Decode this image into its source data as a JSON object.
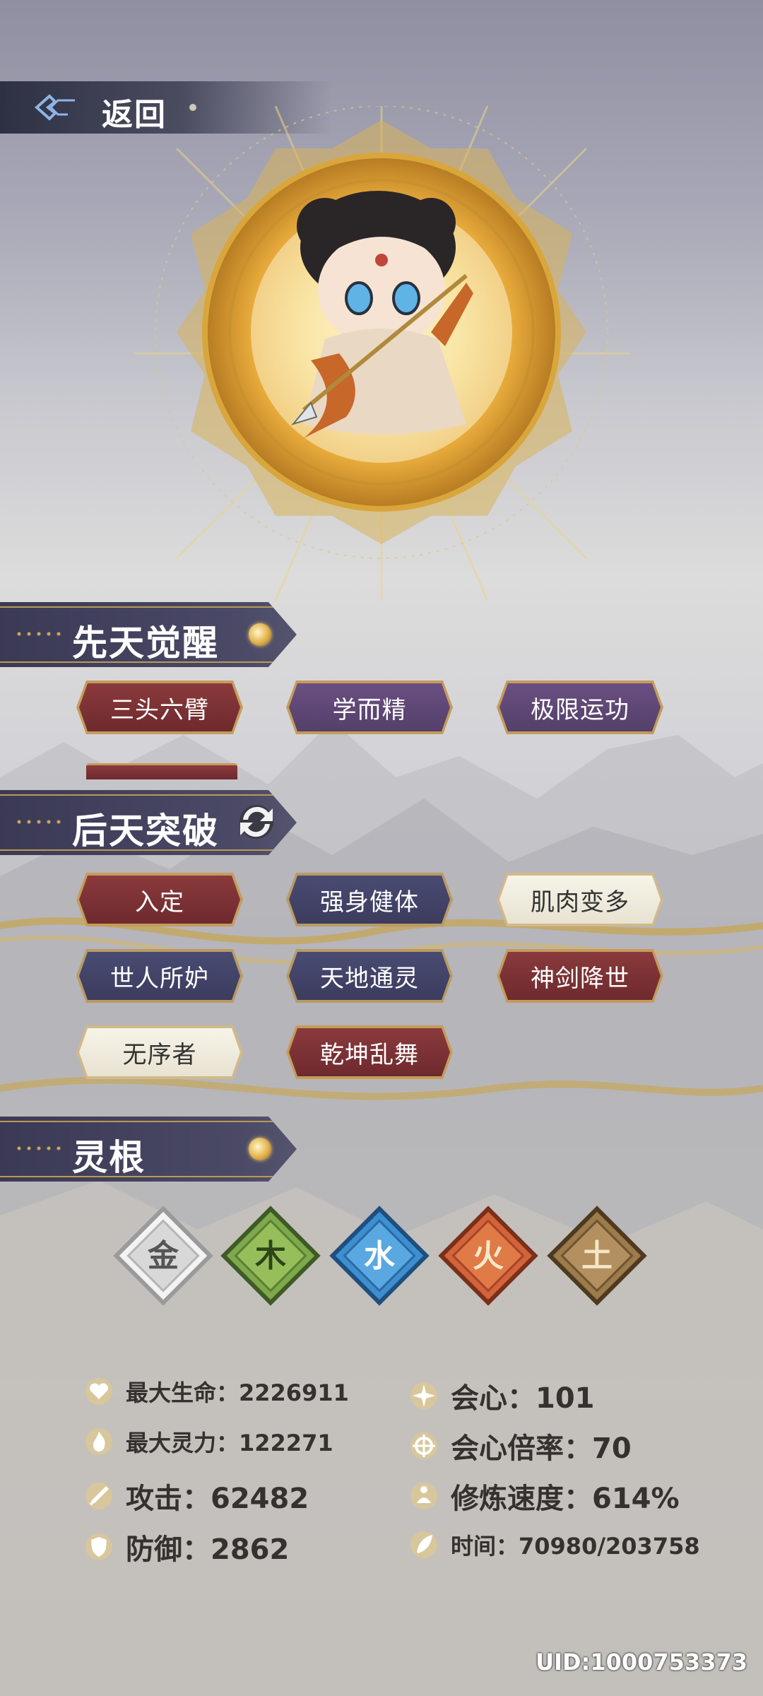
{
  "header": {
    "back_label": "返回"
  },
  "sections": {
    "innate": {
      "title": "先天觉醒",
      "tags": [
        "三头六臂",
        "学而精",
        "极限运功"
      ]
    },
    "acquired": {
      "title": "后天突破",
      "tags": [
        "入定",
        "强身健体",
        "肌肉变多",
        "世人所妒",
        "天地通灵",
        "神剑降世",
        "无序者",
        "乾坤乱舞"
      ]
    },
    "spirit_root": {
      "title": "灵根",
      "elements": [
        "金",
        "木",
        "水",
        "火",
        "土"
      ]
    }
  },
  "stats": {
    "max_hp": "最大生命：2226911",
    "crit": "会心：101",
    "max_spirit": "最大灵力：122271",
    "crit_mult": "会心倍率：70",
    "attack": "攻击：62482",
    "cultivation_speed": "修炼速度：614%",
    "defense": "防御：2862",
    "time": "时间：70980/203758"
  },
  "uid": "UID:1000753373",
  "colors": {
    "gold": "#c59b5a",
    "header_bg": "#3b3a55",
    "metal": "#c8c8c8",
    "wood": "#7da24a",
    "water": "#3c8fd0",
    "fire": "#d2643a",
    "earth": "#9c7b4c"
  }
}
